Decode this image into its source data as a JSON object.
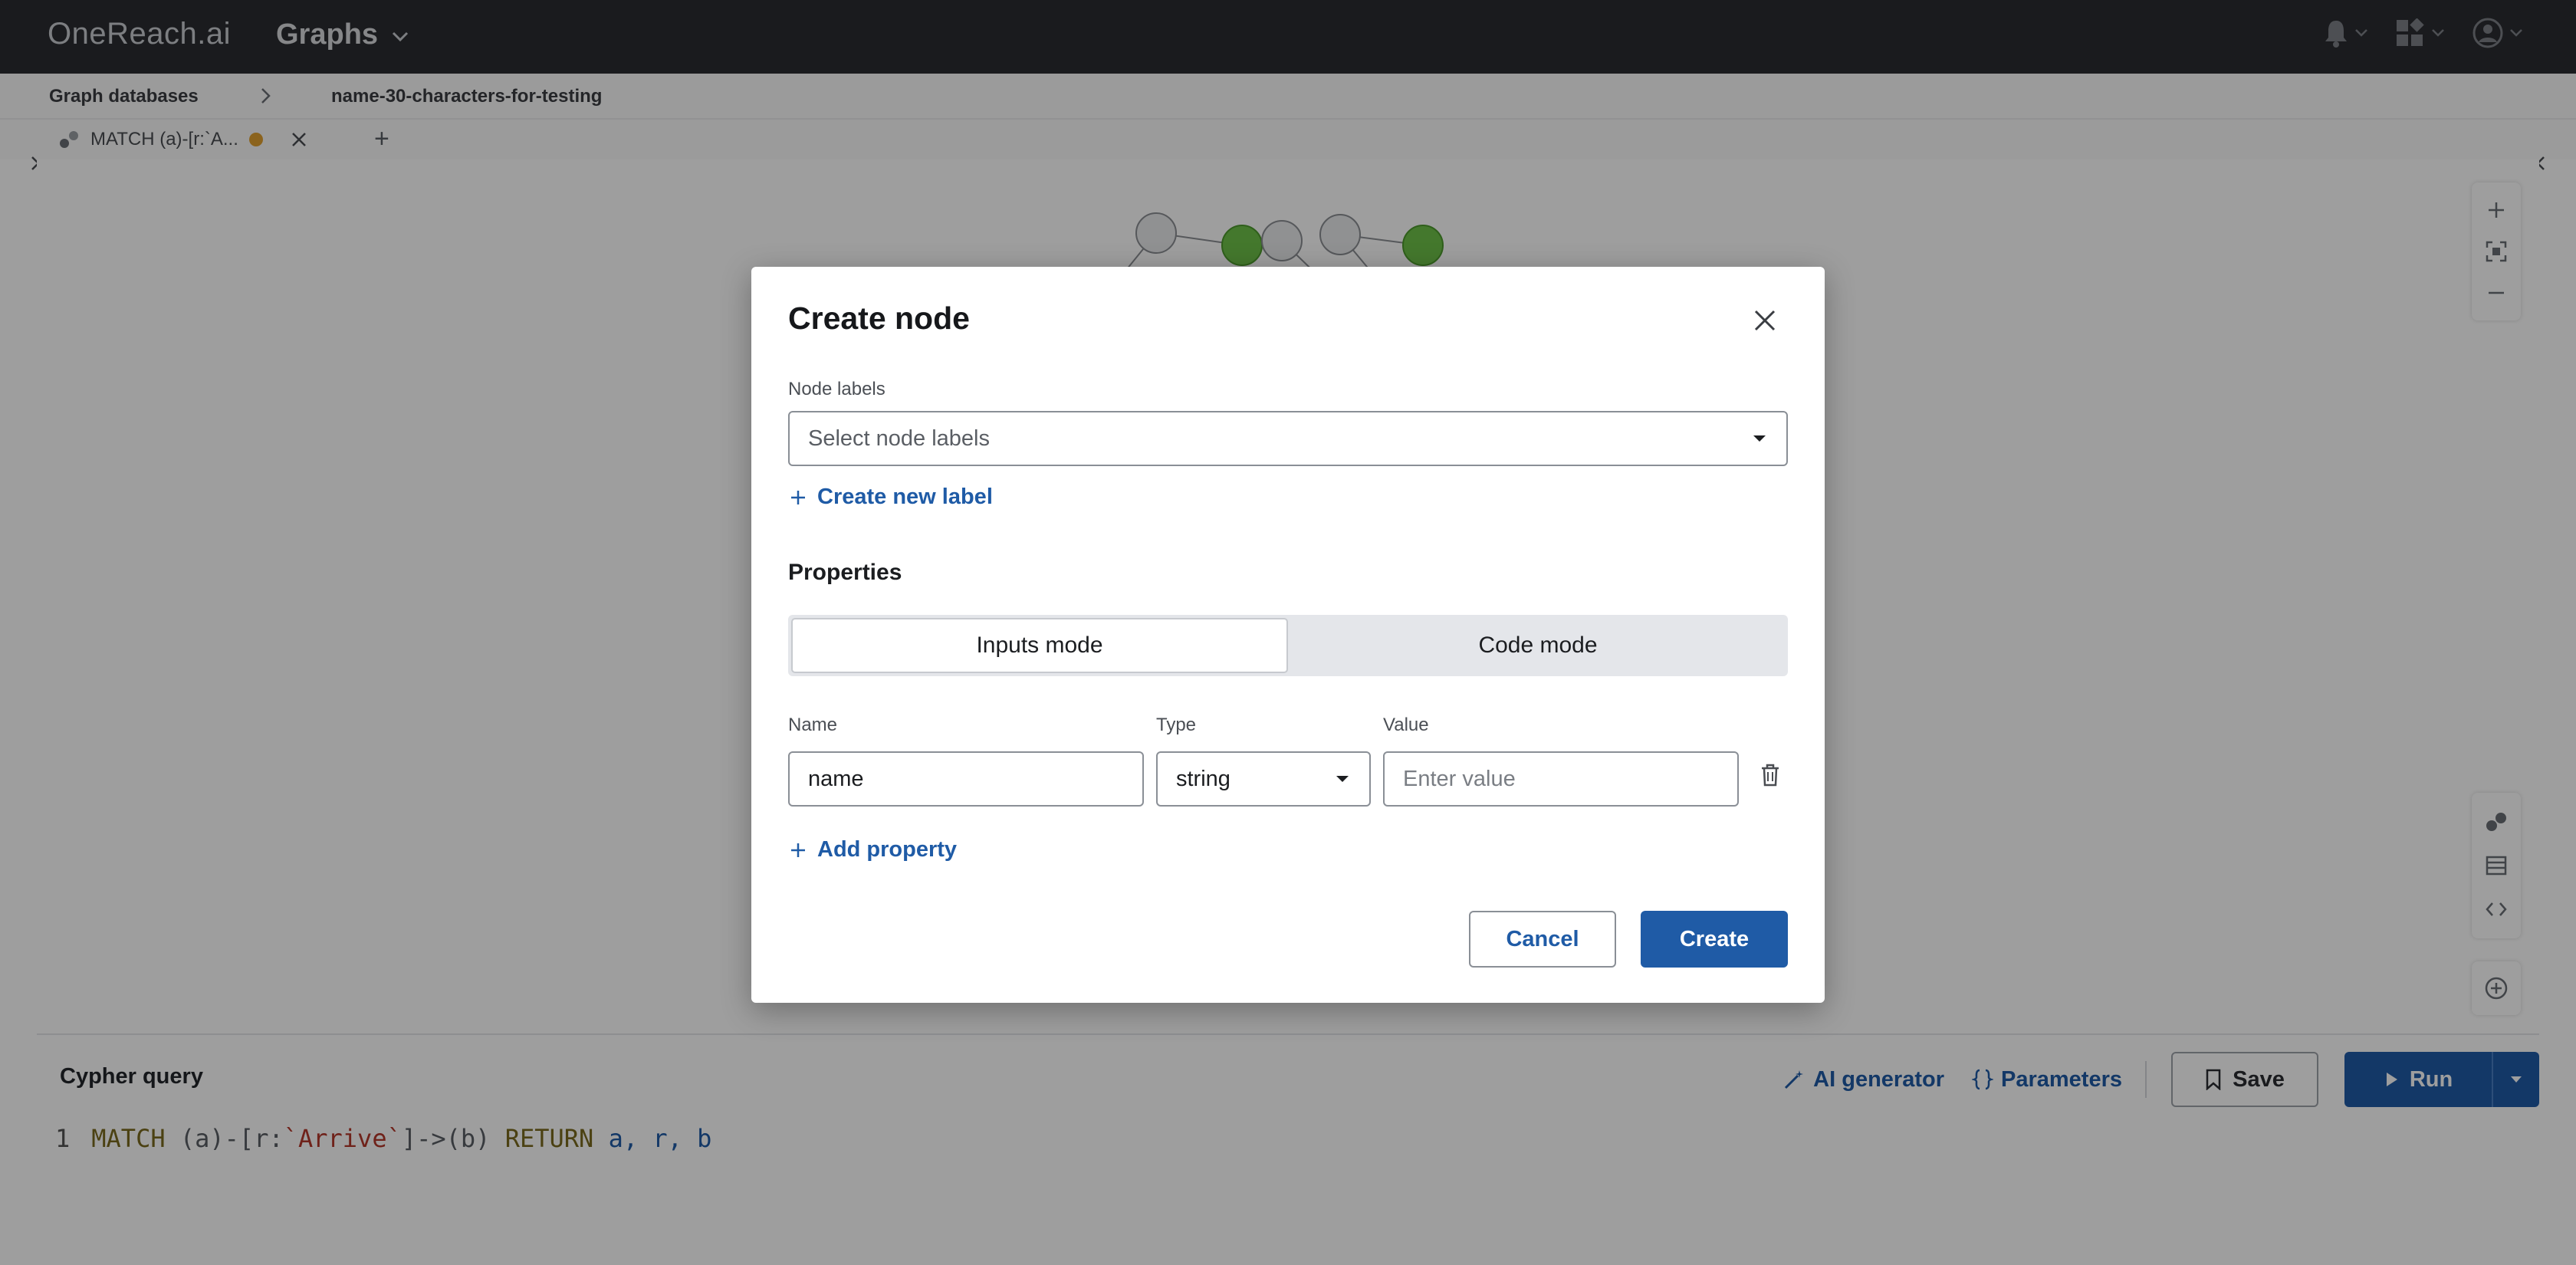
{
  "topbar": {
    "logo": "OneReach.ai",
    "app_name": "Graphs",
    "icons": [
      "bell-icon",
      "apps-icon",
      "user-icon"
    ]
  },
  "breadcrumb": {
    "items": [
      "Graph databases",
      "name-30-characters-for-testing"
    ]
  },
  "tabs": {
    "query_tab_label": "MATCH (a)-[r:`A...",
    "add_tab": "+"
  },
  "query_panel": {
    "title": "Cypher query",
    "ai_generator": "AI generator",
    "parameters": "Parameters",
    "save": "Save",
    "run": "Run",
    "line_number": "1",
    "code": {
      "match": "MATCH",
      "part1": " (a)-[r:",
      "rel": "`Arrive`",
      "part2": "]->(b) ",
      "return": "RETURN",
      "vars": " a, r, b"
    }
  },
  "modal": {
    "title": "Create node",
    "node_labels_label": "Node labels",
    "node_labels_placeholder": "Select node labels",
    "create_new_label": "Create new label",
    "properties_title": "Properties",
    "modes": [
      "Inputs mode",
      "Code mode"
    ],
    "active_mode": "Inputs mode",
    "columns": {
      "name": "Name",
      "type": "Type",
      "value": "Value"
    },
    "property": {
      "name": "name",
      "type": "string",
      "value_placeholder": "Enter value"
    },
    "add_property": "Add property",
    "cancel": "Cancel",
    "create": "Create"
  },
  "colors": {
    "primary": "#1f5ba6",
    "topbar": "#2b2d31",
    "node_green": "#6fc24a",
    "node_grey": "#e9eaec"
  }
}
